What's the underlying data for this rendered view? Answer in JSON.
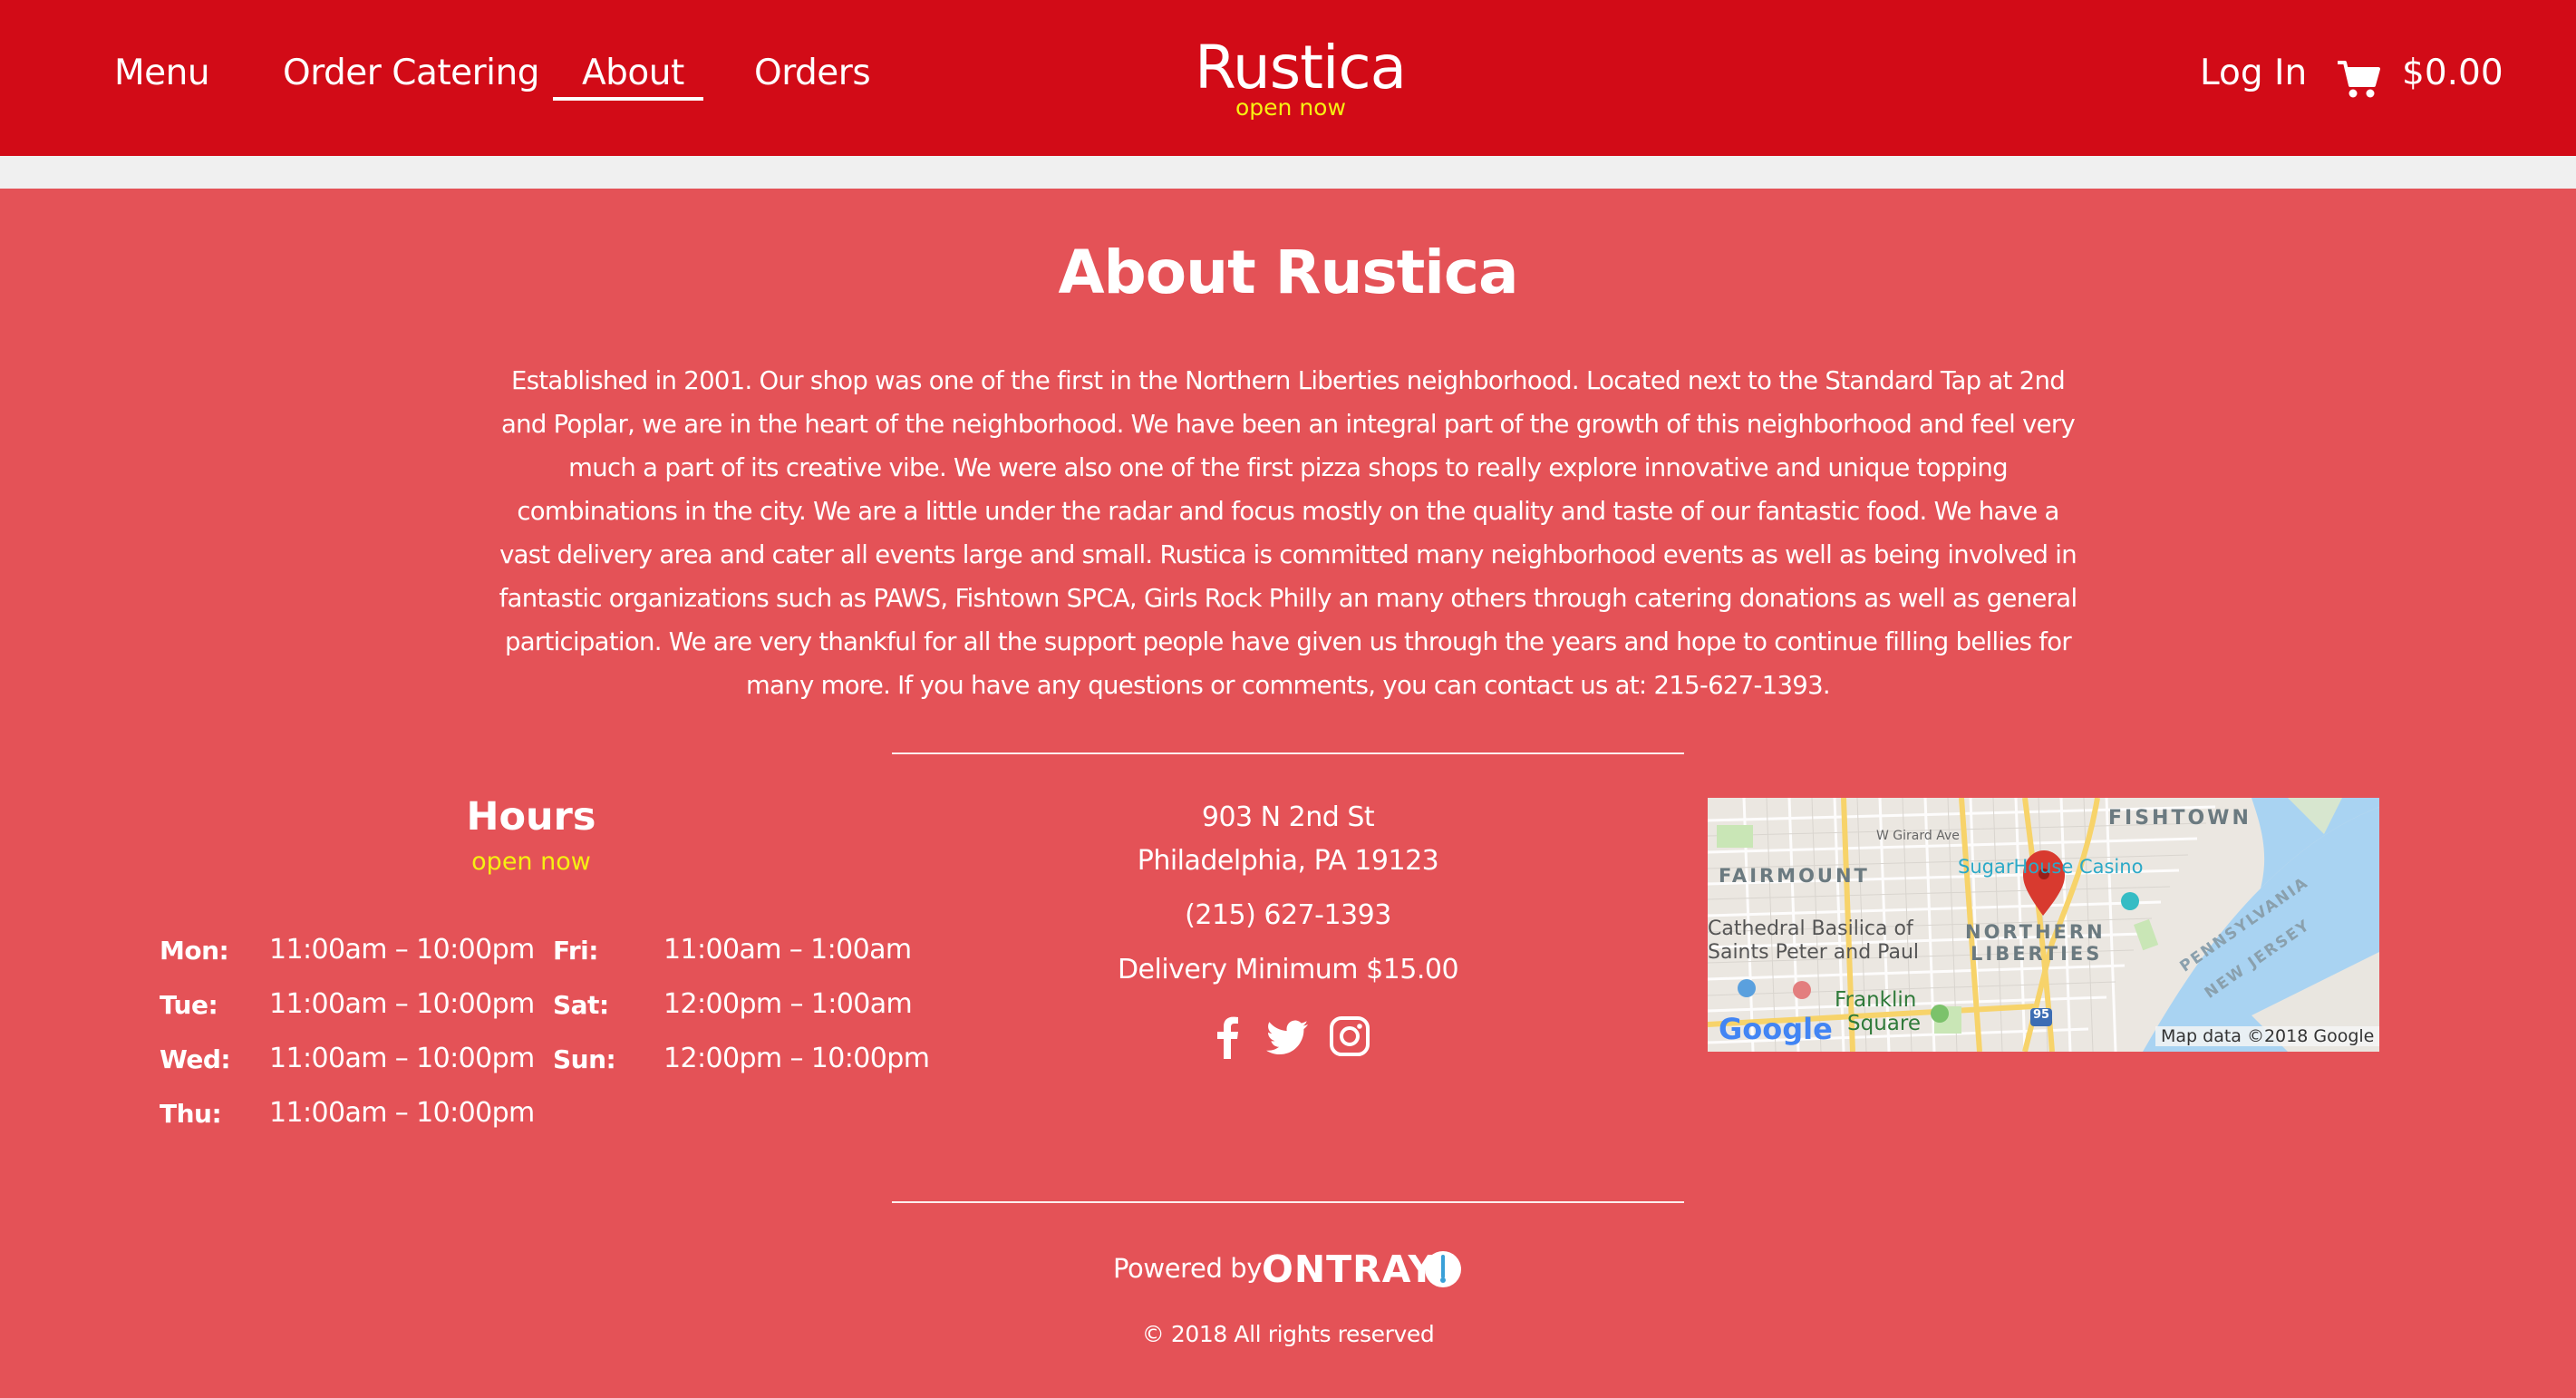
{
  "header": {
    "nav": [
      {
        "label": "Menu"
      },
      {
        "label": "Order Catering"
      },
      {
        "label": "About"
      },
      {
        "label": "Orders"
      }
    ],
    "brand": "Rustica",
    "status": "open now",
    "login_label": "Log In",
    "cart_total": "$0.00",
    "cart_icon": "shopping-cart-icon"
  },
  "about": {
    "title": "About Rustica",
    "text": "Established in 2001. Our shop was one of the first in the Northern Liberties neighborhood. Located next to the Standard Tap at 2nd and Poplar, we are in the heart of the neighborhood. We have been an integral part of the growth of this neighborhood and feel very much a part of its creative vibe. We were also one of the first pizza shops to really explore innovative and unique topping combinations in the city. We are a little under the radar and focus mostly on the quality and taste of our fantastic food. We have a vast delivery area and cater all events large and small. Rustica is committed many neighborhood events as well as being involved in fantastic organizations such as PAWS, Fishtown SPCA, Girls Rock Philly an many others through catering donations as well as general participation. We are very thankful for all the support people have given us through the years and hope to continue filling bellies for many more. If you have any questions or comments, you can contact us at: 215-627-1393."
  },
  "hours": {
    "title": "Hours",
    "status": "open now",
    "days": [
      {
        "day": "Mon:",
        "time": "11:00am – 10:00pm"
      },
      {
        "day": "Tue:",
        "time": "11:00am – 10:00pm"
      },
      {
        "day": "Wed:",
        "time": "11:00am – 10:00pm"
      },
      {
        "day": "Thu:",
        "time": "11:00am – 10:00pm"
      },
      {
        "day": "Fri:",
        "time": "11:00am – 1:00am"
      },
      {
        "day": "Sat:",
        "time": "12:00pm – 1:00am"
      },
      {
        "day": "Sun:",
        "time": "12:00pm – 10:00pm"
      }
    ]
  },
  "contact": {
    "street": "903 N 2nd St",
    "city": "Philadelphia, PA 19123",
    "phone": "(215) 627-1393",
    "delivery_minimum": "Delivery Minimum $15.00",
    "social": [
      "facebook-icon",
      "twitter-icon",
      "instagram-icon"
    ]
  },
  "map": {
    "labels": {
      "fishtown": "FISHTOWN",
      "girard": "W Girard Ave",
      "fairmount": "FAIRMOUNT",
      "sugarhouse": "SugarHouse Casino",
      "cathedral_1": "Cathedral Basilica of",
      "cathedral_2": "Saints Peter and Paul",
      "nl_1": "NORTHERN",
      "nl_2": "LIBERTIES",
      "penn": "PENNSYLVANIA",
      "nj": "NEW JERSEY",
      "franklin_1": "Franklin",
      "franklin_2": "Square",
      "google": "Google",
      "mapdata": "Map data ©2018 Google",
      "route": "95"
    }
  },
  "footer": {
    "powered_by": "Powered by",
    "brand": "ONTRAY",
    "copyright": "© 2018 All rights reserved"
  },
  "colors": {
    "header_bg": "#d20b17",
    "page_bg": "#e45257",
    "status_yellow": "#f6f012"
  }
}
